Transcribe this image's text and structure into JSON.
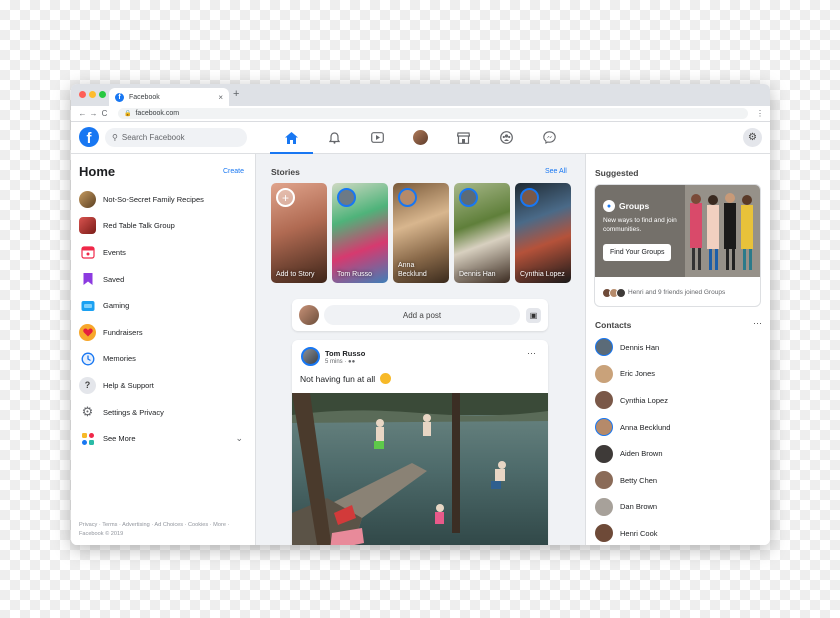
{
  "browser": {
    "tab_title": "Facebook",
    "tab_close": "×",
    "new_tab": "+",
    "url": "facebook.com",
    "back": "←",
    "forward": "→",
    "reload": "C",
    "menu": "⋮"
  },
  "topnav": {
    "logo": "f",
    "search_placeholder": "Search Facebook",
    "icons": [
      "home-icon",
      "bell-icon",
      "watch-icon",
      "profile-avatar",
      "marketplace-icon",
      "groups-icon",
      "messenger-icon"
    ]
  },
  "left": {
    "title": "Home",
    "create": "Create",
    "items": [
      {
        "label": "Not-So-Secret Family Recipes",
        "icon": "group-recipes-icon",
        "color": "#8d6e3f"
      },
      {
        "label": "Red Table Talk Group",
        "icon": "group-redtable-icon",
        "color": "#b3261e"
      },
      {
        "label": "Events",
        "icon": "calendar-icon",
        "color": "#f02849"
      },
      {
        "label": "Saved",
        "icon": "bookmark-icon",
        "color": "#8c3ae0"
      },
      {
        "label": "Gaming",
        "icon": "gaming-icon",
        "color": "#1ba1f2"
      },
      {
        "label": "Fundraisers",
        "icon": "heart-icon",
        "color": "#f26a2e"
      },
      {
        "label": "Memories",
        "icon": "clock-icon",
        "color": "#1877f2"
      },
      {
        "label": "Help & Support",
        "icon": "help-icon",
        "color": "#65676b"
      },
      {
        "label": "Settings & Privacy",
        "icon": "gear-icon",
        "color": "#65676b"
      },
      {
        "label": "See More",
        "icon": "see-more-icon",
        "color": "#2abba7"
      }
    ],
    "footer": "Privacy · Terms · Advertising · Ad Choices · Cookies · More · Facebook © 2019"
  },
  "feed": {
    "stories_title": "Stories",
    "see_all": "See All",
    "stories": [
      {
        "name": "Add to Story",
        "colors": [
          "#d4735c",
          "#7a3b2b"
        ]
      },
      {
        "name": "Tom Russo",
        "colors": [
          "#5fbf7e",
          "#d63a6f"
        ]
      },
      {
        "name": "Anna Becklund",
        "colors": [
          "#c49a6c",
          "#4f3b2a"
        ]
      },
      {
        "name": "Dennis Han",
        "colors": [
          "#6f8f4a",
          "#3c2f25"
        ]
      },
      {
        "name": "Cynthia Lopez",
        "colors": [
          "#2f3b46",
          "#9a4a38"
        ]
      }
    ],
    "composer_label": "Add a post",
    "post": {
      "author": "Tom Russo",
      "time": "5 mins · ",
      "text": "Not having fun at all",
      "more": "···"
    }
  },
  "right": {
    "suggested_title": "Suggested",
    "groups": {
      "title": "Groups",
      "subtitle": "New ways to find and join communities.",
      "button": "Find Your Groups",
      "footer": "Henri and 9 friends joined Groups"
    },
    "contacts_title": "Contacts",
    "contacts_more": "···",
    "contacts": [
      {
        "name": "Dennis Han",
        "color": "#5b6b78",
        "ring": true
      },
      {
        "name": "Eric Jones",
        "color": "#c9a27a",
        "ring": false
      },
      {
        "name": "Cynthia Lopez",
        "color": "#7a5848",
        "ring": false
      },
      {
        "name": "Anna Becklund",
        "color": "#b58a6a",
        "ring": true
      },
      {
        "name": "Aiden Brown",
        "color": "#3e3a38",
        "ring": false
      },
      {
        "name": "Betty Chen",
        "color": "#8a6b58",
        "ring": false
      },
      {
        "name": "Dan Brown",
        "color": "#a7a19a",
        "ring": false
      },
      {
        "name": "Henri Cook",
        "color": "#6e4a38",
        "ring": false
      }
    ]
  }
}
